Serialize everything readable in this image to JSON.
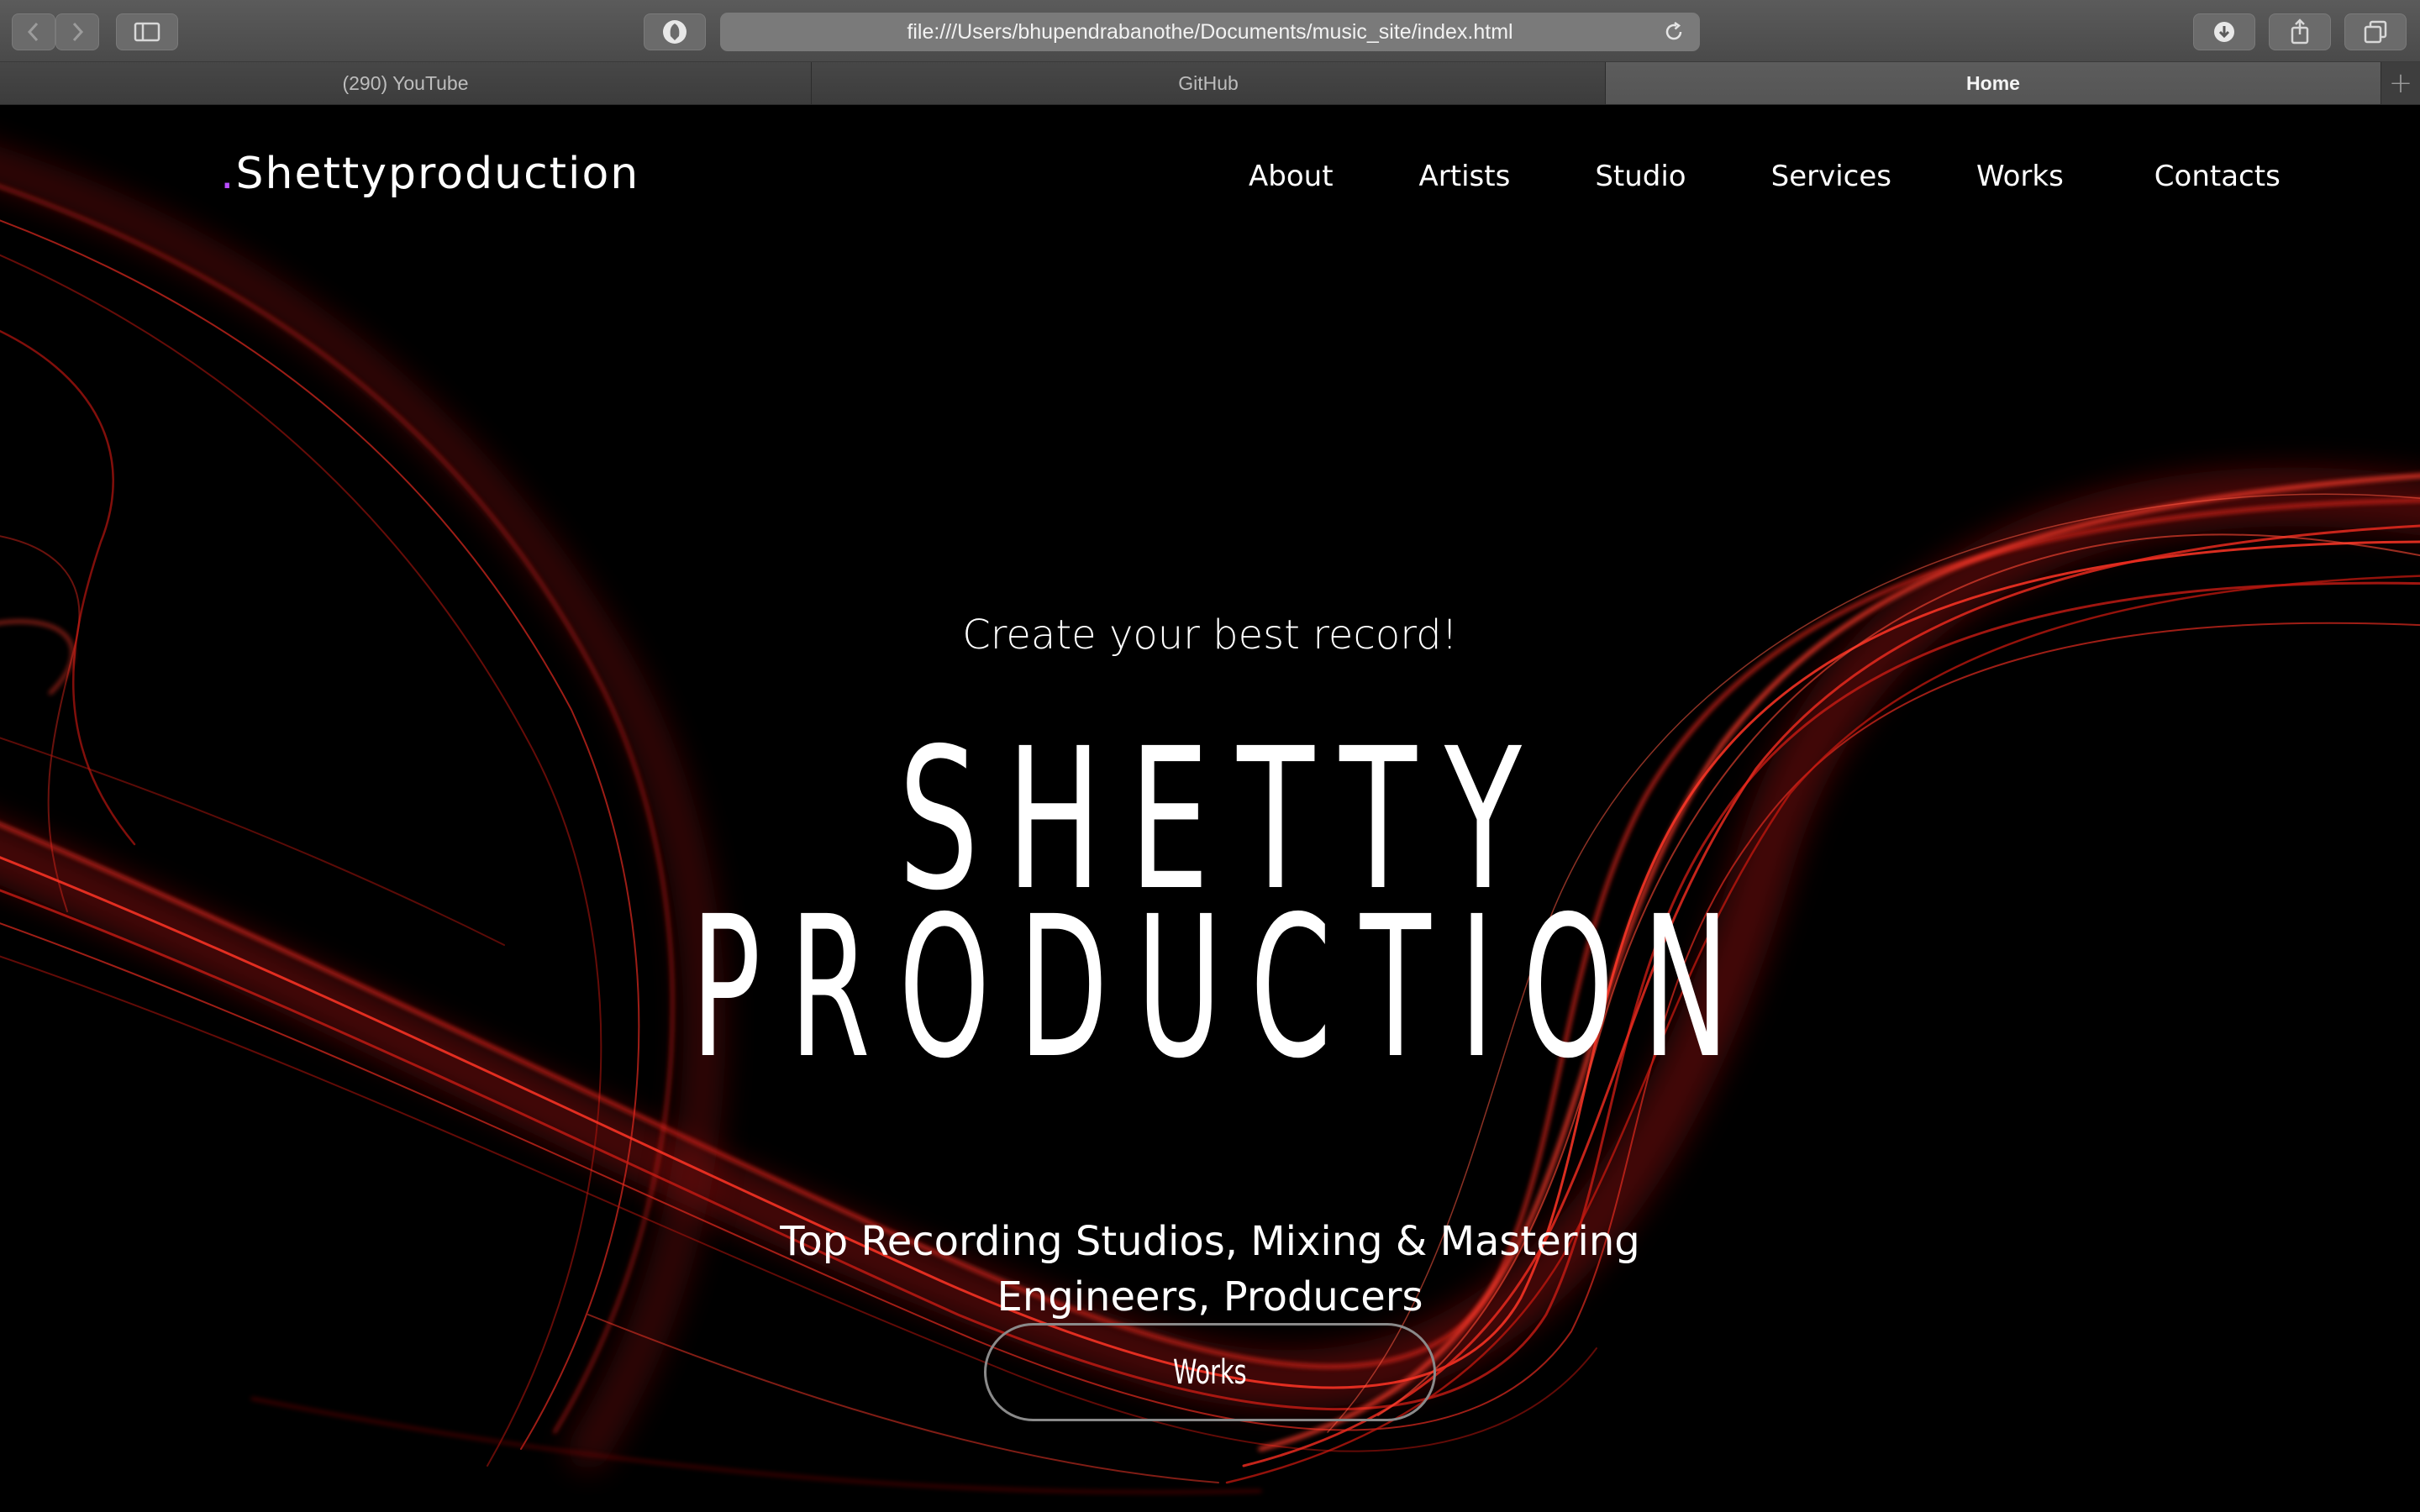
{
  "browser": {
    "url": "file:///Users/bhupendrabanothe/Documents/music_site/index.html",
    "tabs": [
      {
        "label": "(290) YouTube",
        "active": false
      },
      {
        "label": "GitHub",
        "active": false
      },
      {
        "label": "Home",
        "active": true
      }
    ],
    "new_tab_symbol": "+"
  },
  "site": {
    "logo_dot": ".",
    "logo_text": "Shettyproduction",
    "nav": [
      "About",
      "Artists",
      "Studio",
      "Services",
      "Works",
      "Contacts"
    ],
    "hero": {
      "tagline": "Create your best record!",
      "title_line1": "SHETTY",
      "title_line2": "PRODUCTION",
      "subtitle_line1": "Top Recording Studios, Mixing & Mastering",
      "subtitle_line2": "Engineers, Producers",
      "button_label": "Works"
    }
  },
  "colors": {
    "background": "#000000",
    "accent_dot": "#b84dff",
    "smoke": "#e0231c"
  }
}
